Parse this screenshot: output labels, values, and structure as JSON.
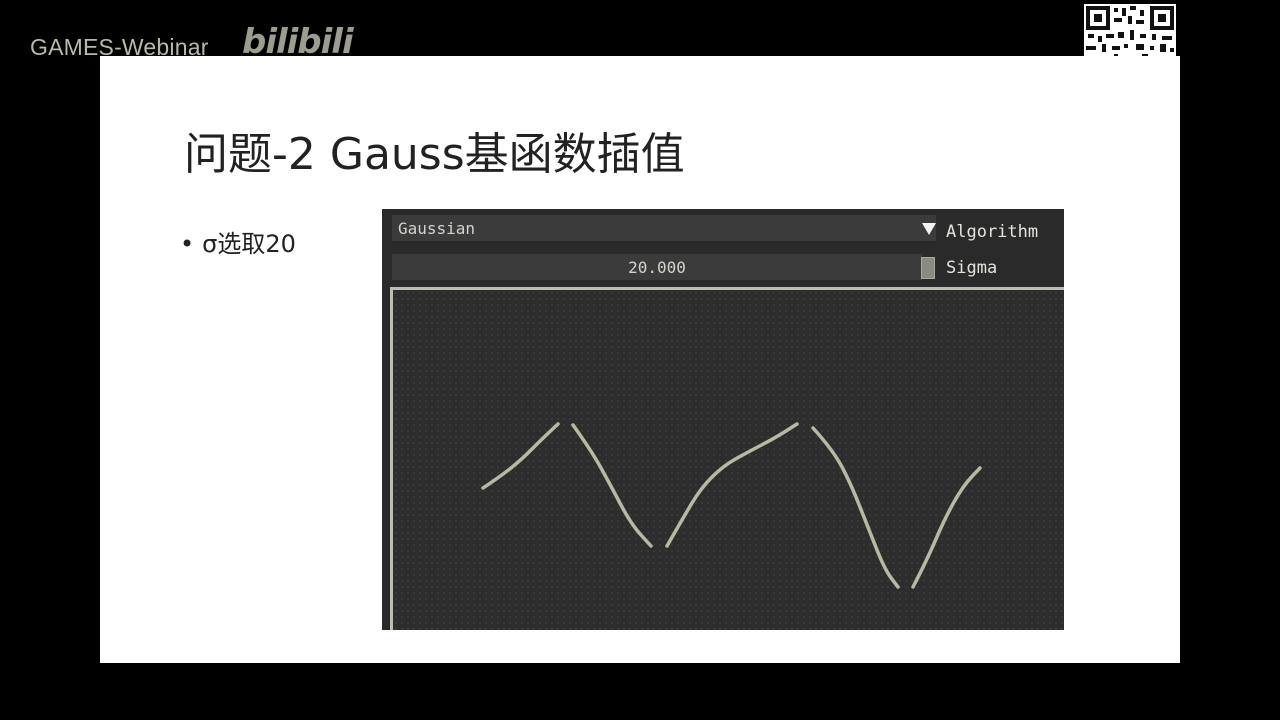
{
  "watermark": {
    "channel": "GAMES-Webinar",
    "logo_text": "bilibili"
  },
  "slide": {
    "title": "问题-2 Gauss基函数插值",
    "bullets": [
      {
        "marker": "•",
        "text": "σ选取20"
      }
    ]
  },
  "app": {
    "algorithm": {
      "value": "Gaussian",
      "label": "Algorithm",
      "arrow_icon": "triangle-down-icon"
    },
    "sigma": {
      "value": "20.000",
      "label": "Sigma"
    },
    "curve_color": "#b9b9a2",
    "background_color": "#2a2a2a",
    "curve_segments": [
      [
        [
          90,
          198
        ],
        [
          108,
          186
        ],
        [
          128,
          170
        ],
        [
          148,
          150
        ],
        [
          165,
          134
        ]
      ],
      [
        [
          180,
          135
        ],
        [
          198,
          160
        ],
        [
          218,
          196
        ],
        [
          238,
          234
        ],
        [
          258,
          256
        ]
      ],
      [
        [
          274,
          256
        ],
        [
          290,
          228
        ],
        [
          308,
          198
        ],
        [
          330,
          176
        ],
        [
          355,
          162
        ],
        [
          382,
          148
        ],
        [
          404,
          134
        ]
      ],
      [
        [
          420,
          138
        ],
        [
          440,
          160
        ],
        [
          458,
          194
        ],
        [
          476,
          240
        ],
        [
          492,
          280
        ],
        [
          505,
          297
        ]
      ],
      [
        [
          520,
          297
        ],
        [
          534,
          270
        ],
        [
          552,
          228
        ],
        [
          570,
          196
        ],
        [
          587,
          178
        ]
      ]
    ]
  }
}
